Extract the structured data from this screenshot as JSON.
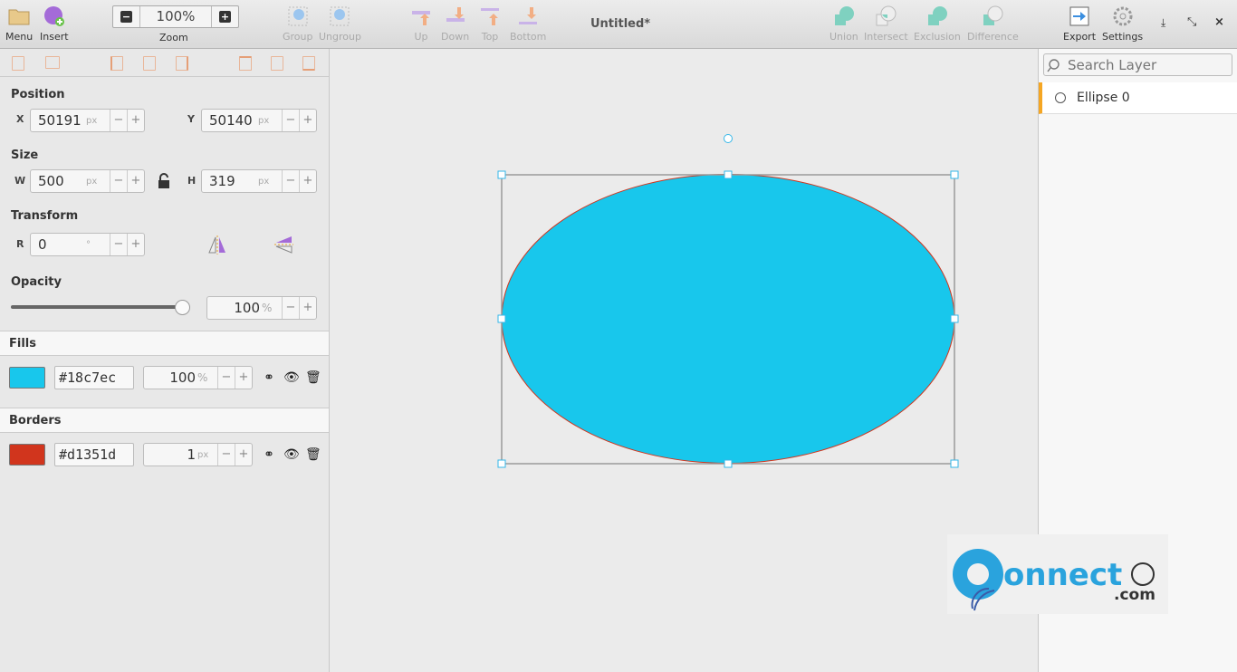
{
  "header": {
    "menu": "Menu",
    "insert": "Insert",
    "zoom_value": "100%",
    "zoom_label": "Zoom",
    "group": "Group",
    "ungroup": "Ungroup",
    "up": "Up",
    "down": "Down",
    "top": "Top",
    "bottom": "Bottom",
    "title": "Untitled*",
    "union": "Union",
    "intersect": "Intersect",
    "exclusion": "Exclusion",
    "difference": "Difference",
    "export": "Export",
    "settings": "Settings"
  },
  "properties": {
    "position": {
      "label": "Position",
      "x_label": "X",
      "x": "50191",
      "y_label": "Y",
      "y": "50140",
      "unit": "px"
    },
    "size": {
      "label": "Size",
      "w_label": "W",
      "w": "500",
      "h_label": "H",
      "h": "319",
      "unit": "px"
    },
    "transform": {
      "label": "Transform",
      "r_label": "R",
      "r": "0",
      "unit": "°"
    },
    "opacity": {
      "label": "Opacity",
      "value": "100",
      "unit": "%",
      "slider_percent": 100
    },
    "minus": "−",
    "plus": "+"
  },
  "fills": {
    "label": "Fills",
    "color": "#18c7ec",
    "hex": "#18c7ec",
    "opacity": "100",
    "unit": "%"
  },
  "borders": {
    "label": "Borders",
    "color": "#d1351d",
    "hex": "#d1351d",
    "width": "1",
    "unit": "px"
  },
  "layers": {
    "search_placeholder": "Search Layer",
    "items": [
      {
        "name": "Ellipse 0",
        "icon": "ellipse-icon"
      }
    ]
  },
  "canvas": {
    "shape": "ellipse",
    "fill": "#18c7ec",
    "stroke": "#d1351d"
  },
  "watermark": "connect.com"
}
